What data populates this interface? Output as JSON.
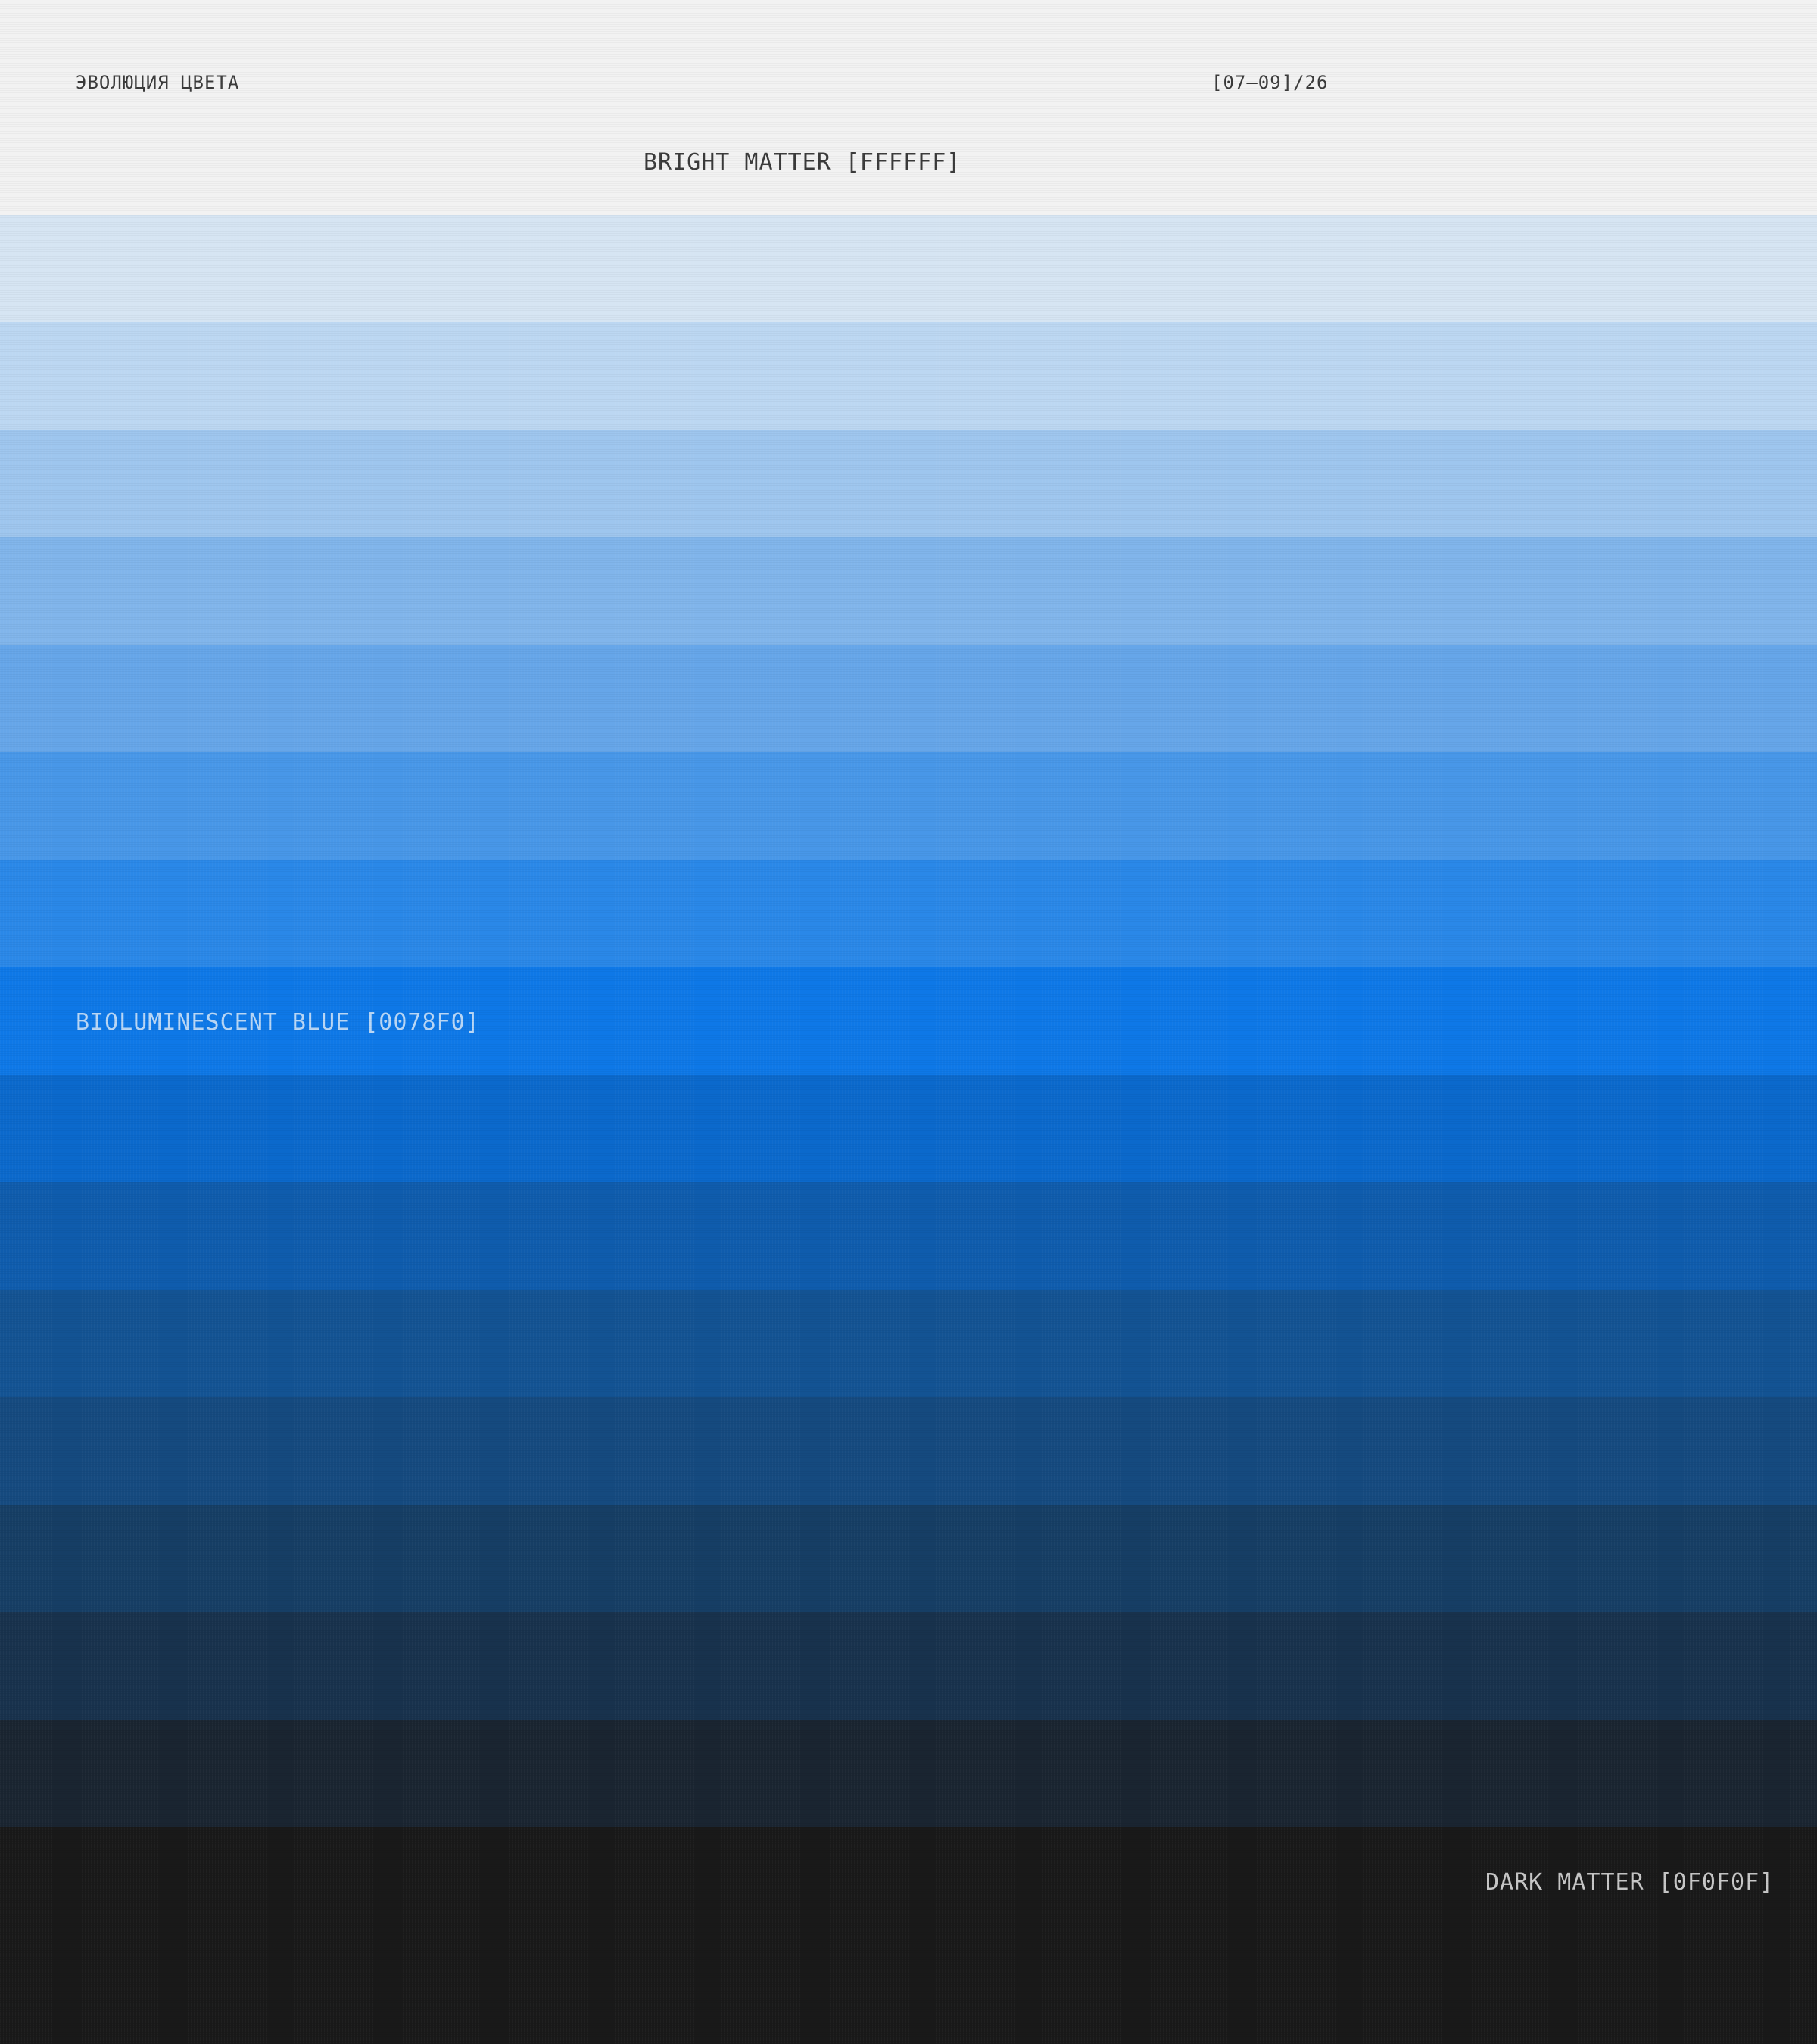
{
  "header": {
    "series_title": "ЭВОЛЮЦИЯ ЦВЕТА",
    "issue": "[07–09]/26"
  },
  "labels": {
    "bright": "BRIGHT MATTER [FFFFFF]",
    "mid": "BIOLUMINESCENT BLUE [0078F0]",
    "dark": "DARK MATTER [0F0F0F]"
  },
  "palette": [
    "#f2f2f2",
    "#d6e5f3",
    "#bcd7f2",
    "#9ec6ee",
    "#81b5eb",
    "#66a6e9",
    "#4897e8",
    "#2a88e8",
    "#0e78e7",
    "#0b69cc",
    "#0f5cad",
    "#135393",
    "#154a7f",
    "#163e65",
    "#18324d",
    "#1a2531",
    "#191919"
  ],
  "colors": {
    "text_dark": "#3a3a3a",
    "text_light_mid": "#b9d7f6",
    "text_light_dark": "#c7c7c7"
  }
}
